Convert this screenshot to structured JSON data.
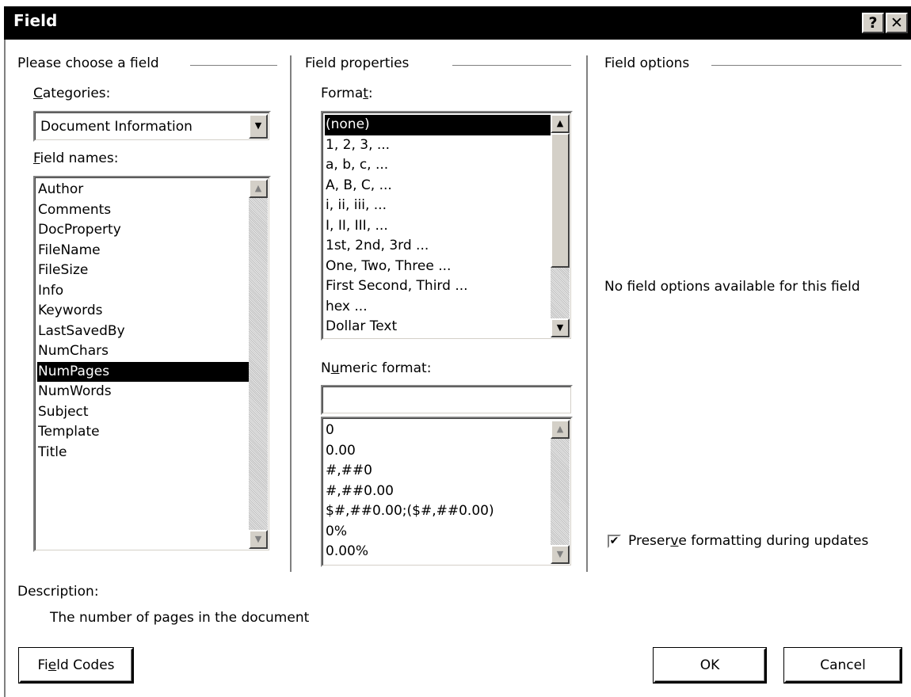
{
  "window": {
    "title": "Field",
    "help_glyph": "?",
    "close_glyph": "✕"
  },
  "groups": {
    "choose": "Please choose a field",
    "properties": "Field properties",
    "options": "Field options"
  },
  "categories": {
    "label_prefix": "",
    "label_key": "C",
    "label_rest": "ategories:",
    "value": "Document Information"
  },
  "field_names": {
    "label_key": "F",
    "label_rest": "ield names:",
    "items": [
      "Author",
      "Comments",
      "DocProperty",
      "FileName",
      "FileSize",
      "Info",
      "Keywords",
      "LastSavedBy",
      "NumChars",
      "NumPages",
      "NumWords",
      "Subject",
      "Template",
      "Title"
    ],
    "selected": "NumPages"
  },
  "format": {
    "label_pre": "Forma",
    "label_key": "t",
    "label_rest": ":",
    "items": [
      "(none)",
      "1, 2, 3, ...",
      "a, b, c, ...",
      "A, B, C, ...",
      "i, ii, iii, ...",
      "I, II, III, ...",
      "1st, 2nd, 3rd ...",
      "One, Two, Three ...",
      "First Second, Third ...",
      "hex ...",
      "Dollar Text"
    ],
    "selected": "(none)"
  },
  "numeric_format": {
    "label_pre": "N",
    "label_key": "u",
    "label_rest": "meric format:",
    "value": "",
    "items": [
      "0",
      "0.00",
      "#,##0",
      "#,##0.00",
      "$#,##0.00;($#,##0.00)",
      "0%",
      "0.00%"
    ]
  },
  "field_options": {
    "message": "No field options available for this field"
  },
  "preserve": {
    "label_pre": "Preser",
    "label_key": "v",
    "label_rest": "e formatting during updates",
    "checked": true
  },
  "description": {
    "label": "Description:",
    "text": "The number of pages in the document"
  },
  "buttons": {
    "field_codes_pre": "Fi",
    "field_codes_key": "e",
    "field_codes_rest": "ld Codes",
    "ok": "OK",
    "cancel": "Cancel"
  },
  "icons": {
    "scroll_up": "up-arrow-icon",
    "scroll_down": "down-arrow-icon",
    "checkmark": "checkmark-icon"
  }
}
